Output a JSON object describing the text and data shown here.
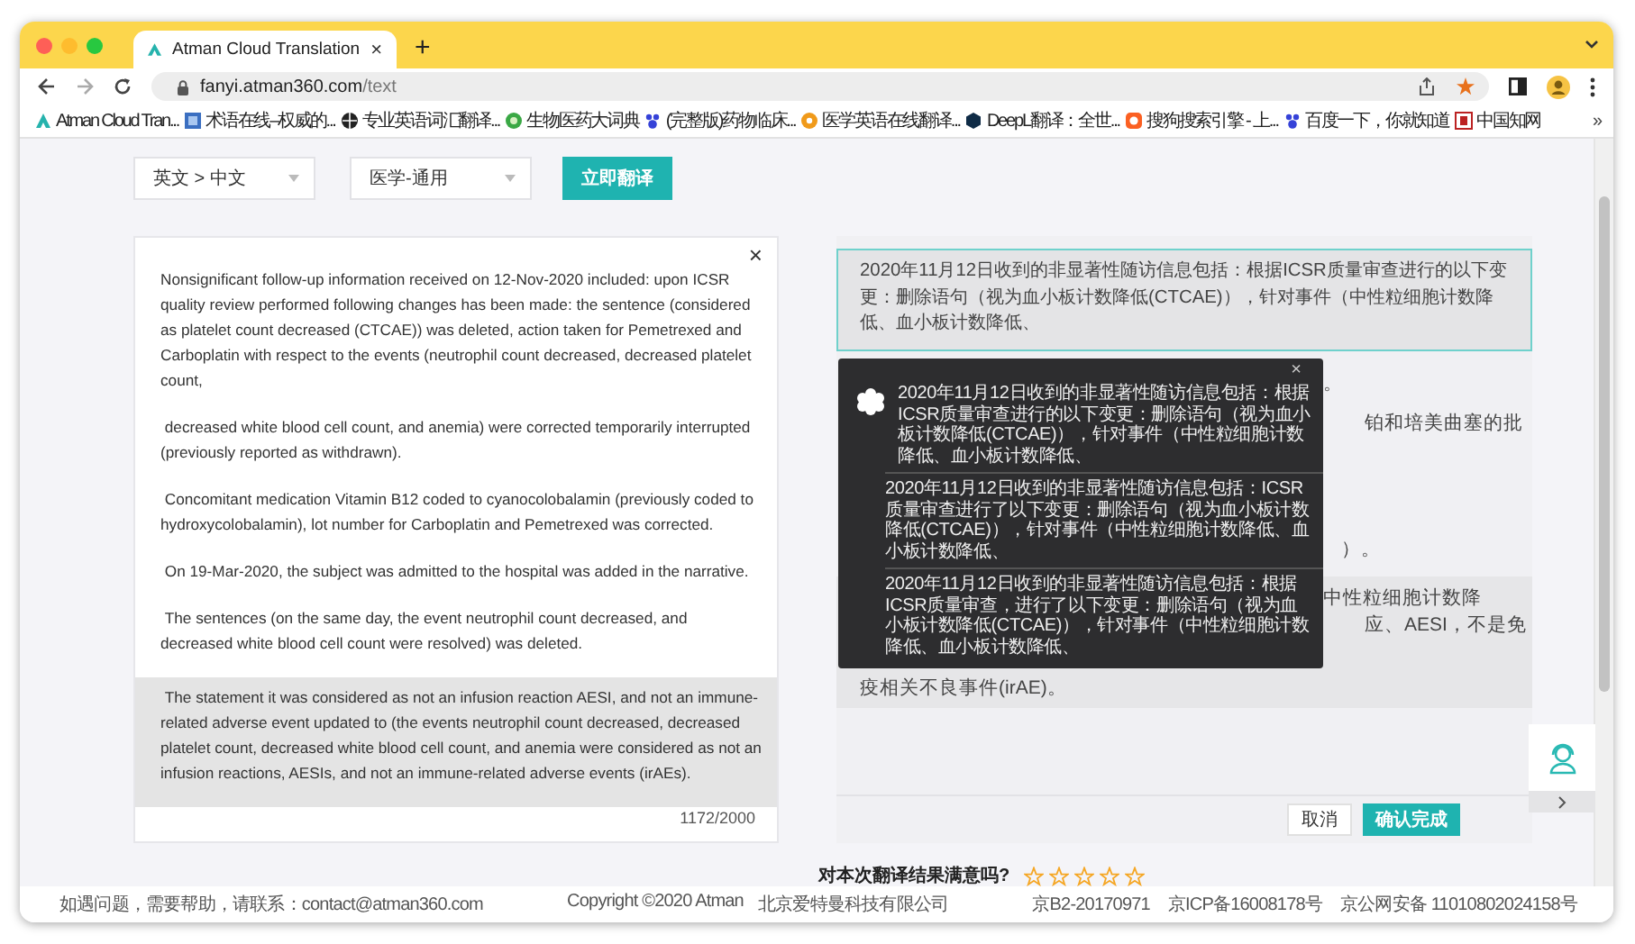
{
  "browser": {
    "tab": {
      "title": "Atman Cloud Translation",
      "close": "×",
      "selected": true
    },
    "new_tab": "+",
    "address": {
      "host": "fanyi.atman360.com",
      "path": "/text"
    },
    "bookmarks": [
      "Atman Cloud Tran...",
      "术语在线–权威的...",
      "专业英语词汇翻译...",
      "生物医药大词典",
      "(完整版)药物临床...",
      "医学英语在线翻译...",
      "DeepL翻译：全世...",
      "搜狗搜索引擎 - 上...",
      "百度一下，你就知道",
      "中国知网"
    ],
    "bookmarks_more": "»"
  },
  "toolbar": {
    "language": "英文 > 中文",
    "domain": "医学-通用",
    "translate_button": "立即翻译"
  },
  "source": {
    "close": "×",
    "paragraphs": [
      {
        "text": "Nonsignificant follow-up information received on 12-Nov-2020 included: upon ICSR quality review performed following changes has been made: the sentence (considered as platelet count decreased (CTCAE)) was deleted, action taken for Pemetrexed and Carboplatin with respect to the events (neutrophil count decreased, decreased platelet count,",
        "selected": false
      },
      {
        "text": " decreased white blood cell count, and anemia) were corrected temporarily interrupted (previously reported as withdrawn).",
        "selected": false
      },
      {
        "text": " Concomitant medication Vitamin B12 coded to cyanocolobalamin (previously coded to hydroxycolobalamin), lot number for Carboplatin and Pemetrexed was corrected.",
        "selected": false
      },
      {
        "text": " On 19-Mar-2020, the subject was admitted to the hospital was added in the narrative.",
        "selected": false
      },
      {
        "text": " The sentences (on the same day, the event neutrophil count decreased, and decreased white blood cell count were resolved) was deleted.",
        "selected": false
      },
      {
        "text": " The statement it was considered as not an infusion reaction AESI, and not an immune-related adverse event updated to (the events neutrophil count decreased, decreased platelet count, decreased white blood cell count, and anemia were considered as not an infusion reactions, AESIs, and not an immune-related adverse events (irAEs).",
        "selected": true
      }
    ],
    "counter": "1172/2000"
  },
  "target": {
    "active_paragraph": "2020年11月12日收到的非显著性随访信息包括：根据ICSR质量审查进行的以下变更：删除语句（视为血小板计数降低(CTCAE)），针对事件（中性粒细胞计数降低、血小板计数降低、",
    "fragments": [
      "。",
      "铂和培美曲塞的批",
      "）。",
      "中性粒细胞计数降",
      "应、AESI，不是免",
      "疫相关不良事件(irAE)。"
    ],
    "cancel_button": "取消",
    "confirm_button": "确认完成"
  },
  "suggestions": {
    "close": "×",
    "items": [
      "2020年11月12日收到的非显著性随访信息包括：根据ICSR质量审查进行的以下变更：删除语句（视为血小板计数降低(CTCAE)），针对事件（中性粒细胞计数降低、血小板计数降低、",
      "2020年11月12日收到的非显著性随访信息包括：ICSR质量审查进行了以下变更：删除语句（视为血小板计数降低(CTCAE)），针对事件（中性粒细胞计数降低、血小板计数降低、",
      "2020年11月12日收到的非显著性随访信息包括：根据ICSR质量审查，进行了以下变更：删除语句（视为血小板计数降低(CTCAE)），针对事件（中性粒细胞计数降低、血小板计数降低、"
    ]
  },
  "rating": {
    "question": "对本次翻译结果满意吗?",
    "stars": 0
  },
  "footer": {
    "contact": "如遇问题，需要帮助，请联系：contact@atman360.com",
    "copyright": "Copyright ©2020 Atman",
    "company": "北京爱特曼科技有限公司",
    "licenses": [
      "京B2-20170971",
      "京ICP备16008178号",
      "京公网安备 11010802024158号"
    ]
  }
}
